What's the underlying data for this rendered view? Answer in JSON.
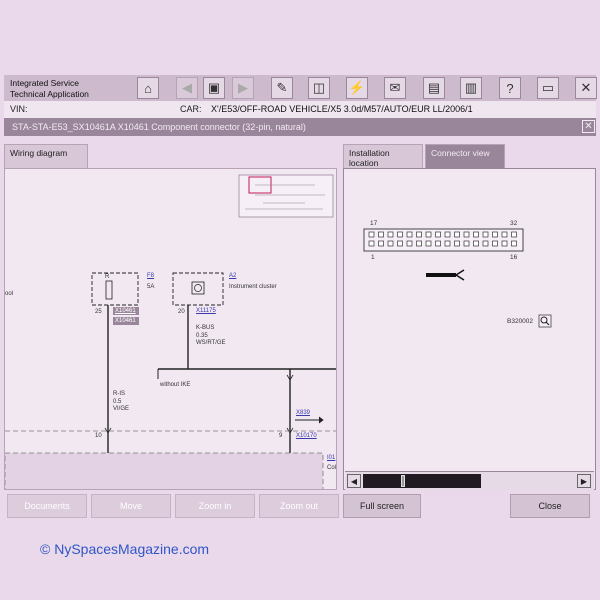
{
  "app": {
    "title_line1": "Integrated Service",
    "title_line2": "Technical Application"
  },
  "toolbar": {
    "buttons": [
      "home-icon",
      "back-icon",
      "overview-icon",
      "forward-icon",
      "wrench-icon",
      "documents-icon",
      "plug-icon",
      "mail-icon",
      "calculator-icon",
      "print-icon",
      "help-icon",
      "window-icon",
      "close-icon"
    ],
    "glyphs": [
      "⌂",
      "◀",
      "▣",
      "▶",
      "✎",
      "◫",
      "⚡",
      "✉",
      "▤",
      "▥",
      "?",
      "▭",
      "✕"
    ],
    "accent_color": "#c0185a"
  },
  "vin": {
    "label": "VIN:",
    "value": ""
  },
  "car": {
    "label": "CAR:",
    "value": "X'/E53/OFF-ROAD VEHICLE/X5 3.0d/M57/AUTO/EUR LL/2006/1"
  },
  "window": {
    "title": "STA-STA-E53_SX10461A X10461 Component connector (32-pin, natural)",
    "close_glyph": "✕"
  },
  "tabs": {
    "wiring": "Wiring diagram",
    "installation": "Installation location",
    "connector": "Connector view"
  },
  "diagram": {
    "left_cut": "ool",
    "fuse_ref": "F8",
    "fuse_rating": "5A",
    "fuse_letter": "R",
    "pin_left": "25",
    "conn_a": "X10461",
    "conn_b": "X10461",
    "cluster_ref": "A2",
    "cluster_name": "Instrument cluster",
    "pin_mid": "20",
    "conn_c": "X11175",
    "bus_name": "K-BUS",
    "bus_size": "0.35",
    "bus_color": "WS/RT/GE",
    "ike_note": "without IKE",
    "wire_name": "R-IS",
    "wire_size": "0.5",
    "wire_color": "VI/GE",
    "node_10": "10",
    "node_9": "9",
    "conn_d": "X839",
    "conn_e": "X10170",
    "right_ref": "I01",
    "right_cut": "Col"
  },
  "connector_view": {
    "pin_17": "17",
    "pin_32": "32",
    "pin_1": "1",
    "pin_16": "16",
    "image_id": "B320002",
    "scroll_position": 0.33
  },
  "bottom_buttons": {
    "documents": "Documents",
    "move": "Move",
    "zoom_in": "Zoom in",
    "zoom_out": "Zoom out",
    "full_screen": "Full screen",
    "close": "Close"
  },
  "watermark": "© NySpacesMagazine.com"
}
